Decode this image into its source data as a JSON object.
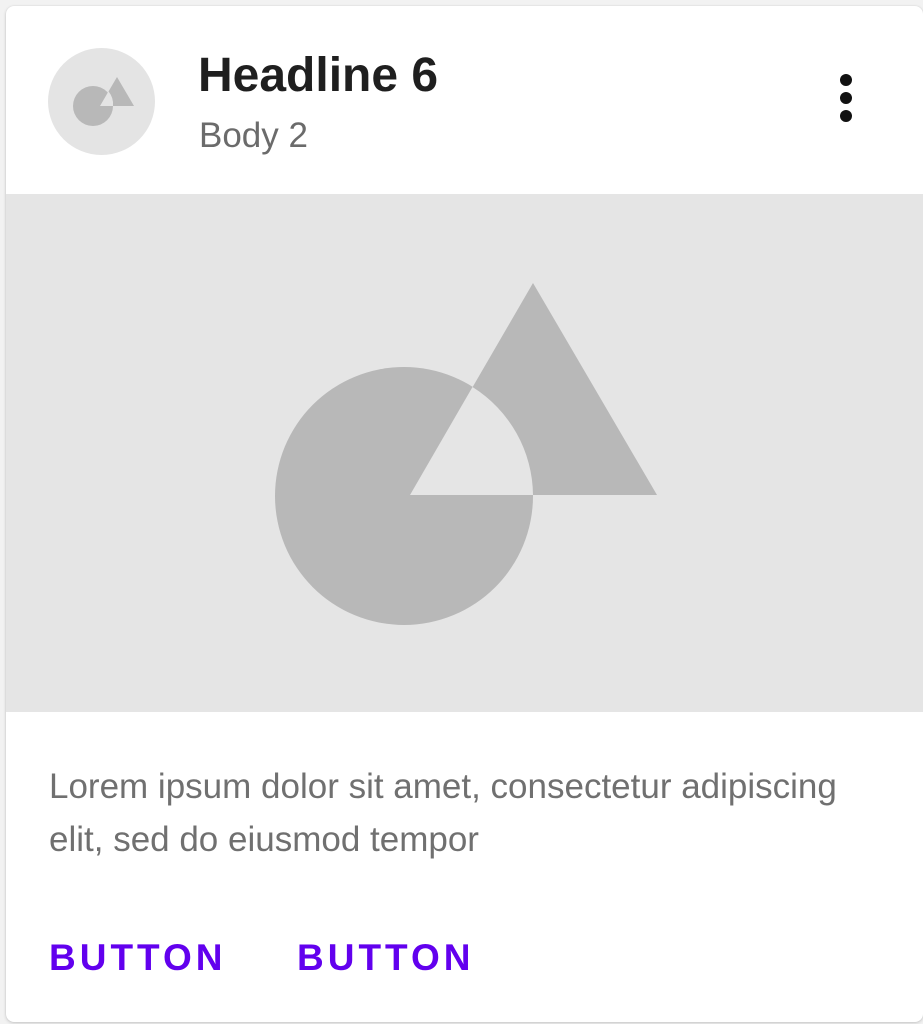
{
  "card": {
    "header": {
      "avatar_icon": "shapes-placeholder-icon",
      "title": "Headline 6",
      "subtitle": "Body 2",
      "overflow_icon": "more-vert-icon"
    },
    "media": {
      "icon": "shapes-placeholder-icon"
    },
    "supporting_text": "Lorem ipsum dolor sit amet, consectetur adipiscing elit, sed do eiusmod tempor",
    "actions": [
      {
        "label": "BUTTON"
      },
      {
        "label": "BUTTON"
      }
    ]
  },
  "colors": {
    "primary": "#6200ee",
    "placeholder_bg": "#e5e5e5",
    "placeholder_shape": "#b8b8b8",
    "title": "#1f1f1f",
    "secondary_text": "#6b6b6b"
  }
}
